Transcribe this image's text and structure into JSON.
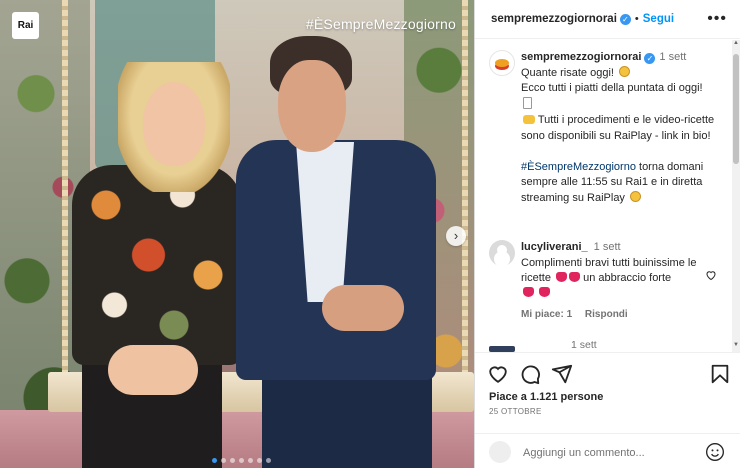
{
  "media": {
    "logo_text": "Rai",
    "overlay_hashtag": "#ÈSempreMezzogiorno",
    "carousel_dots": 7,
    "carousel_active_index": 0
  },
  "header": {
    "username": "sempremezzogiornorai",
    "separator": "•",
    "follow_label": "Segui",
    "more_icon": "more-horizontal-icon"
  },
  "caption": {
    "username": "sempremezzogiornorai",
    "time": "1 sett",
    "line1": "Quante risate oggi!",
    "line2": "Ecco tutti i piatti della puntata di oggi!",
    "line3": "Tutti i procedimenti e le video-ricette sono disponibili su RaiPlay - link in bio!",
    "hashtag": "#ÈSempreMezzogiorno",
    "line4": " torna domani sempre alle 11:55 su Rai1 e in diretta streaming su RaiPlay"
  },
  "comment": {
    "username": "lucyliverani_",
    "time": "1 sett",
    "text": "Complimenti bravi tutti buinissime le ricette",
    "text2": "un abbraccio forte",
    "likes_label": "Mi piace: 1",
    "reply_label": "Rispondi"
  },
  "next_comment": {
    "time": "1 sett"
  },
  "actions": {
    "likes": "Piace a 1.121 persone",
    "date": "25 OTTOBRE",
    "comment_placeholder": "Aggiungi un commento..."
  },
  "colors": {
    "link": "#0095f6",
    "verified": "#3897f0",
    "hashtag": "#00376b"
  }
}
